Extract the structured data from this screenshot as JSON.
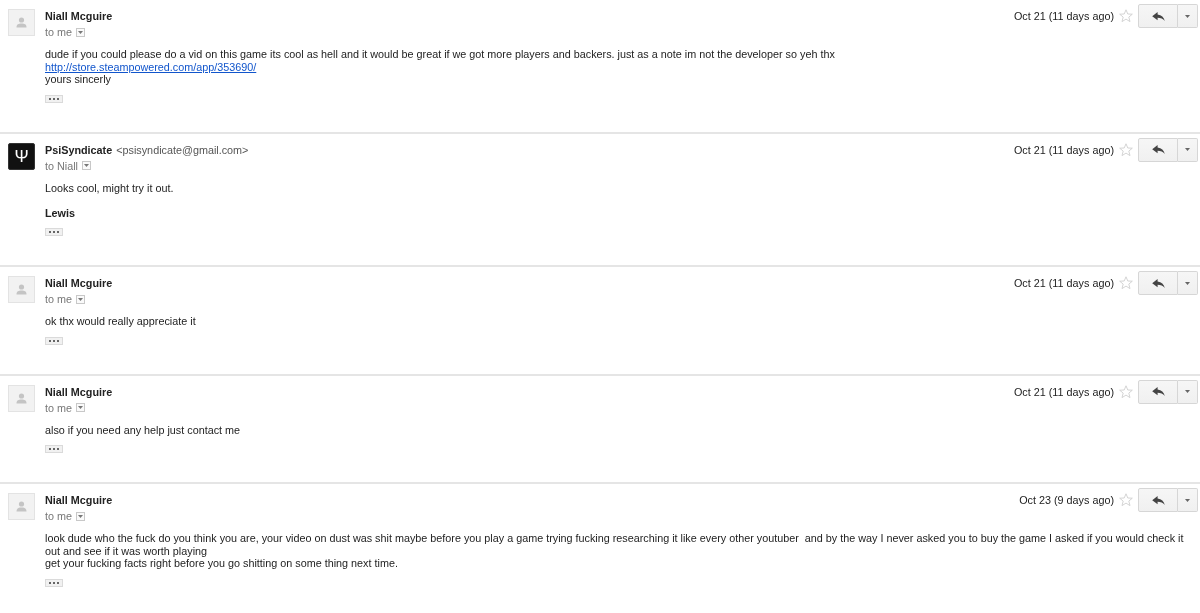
{
  "messages": [
    {
      "avatar": {
        "kind": "placeholder"
      },
      "sender": {
        "name": "Niall Mcguire"
      },
      "recipient": "to me",
      "date": "Oct 21 (11 days ago)",
      "starred": false,
      "body": [
        {
          "kind": "text",
          "text": "dude if you could please do a vid on this game its cool as hell and it would be great if we got more players and backers. just as a note im not the developer so yeh thx"
        },
        {
          "kind": "link",
          "text": "http://store.steampowered.com/app/353690/"
        },
        {
          "kind": "text",
          "text": "yours sincerly"
        }
      ]
    },
    {
      "avatar": {
        "kind": "logo",
        "glyph": "Ψ"
      },
      "sender": {
        "name": "PsiSyndicate",
        "email": "<psisyndicate@gmail.com>"
      },
      "recipient": "to Niall",
      "date": "Oct 21 (11 days ago)",
      "starred": false,
      "body": [
        {
          "kind": "text",
          "text": "Looks cool, might try it out."
        },
        {
          "kind": "signature",
          "text": "Lewis"
        }
      ]
    },
    {
      "avatar": {
        "kind": "placeholder"
      },
      "sender": {
        "name": "Niall Mcguire"
      },
      "recipient": "to me",
      "date": "Oct 21 (11 days ago)",
      "starred": false,
      "body": [
        {
          "kind": "text",
          "text": "ok thx would really appreciate it"
        }
      ]
    },
    {
      "avatar": {
        "kind": "placeholder"
      },
      "sender": {
        "name": "Niall Mcguire"
      },
      "recipient": "to me",
      "date": "Oct 21 (11 days ago)",
      "starred": false,
      "body": [
        {
          "kind": "text",
          "text": "also if you need any help just contact me"
        }
      ]
    },
    {
      "avatar": {
        "kind": "placeholder"
      },
      "sender": {
        "name": "Niall Mcguire"
      },
      "recipient": "to me",
      "date": "Oct 23 (9 days ago)",
      "starred": false,
      "body": [
        {
          "kind": "text",
          "text": "look dude who the fuck do you think you are, your video on dust was shit maybe before you play a game trying fucking researching it like every other youtuber  and by the way I never asked you to buy the game I asked if you would check it out and see if it was worth playing"
        },
        {
          "kind": "text",
          "text": "get your fucking facts right before you go shitting on some thing next time."
        }
      ]
    }
  ]
}
